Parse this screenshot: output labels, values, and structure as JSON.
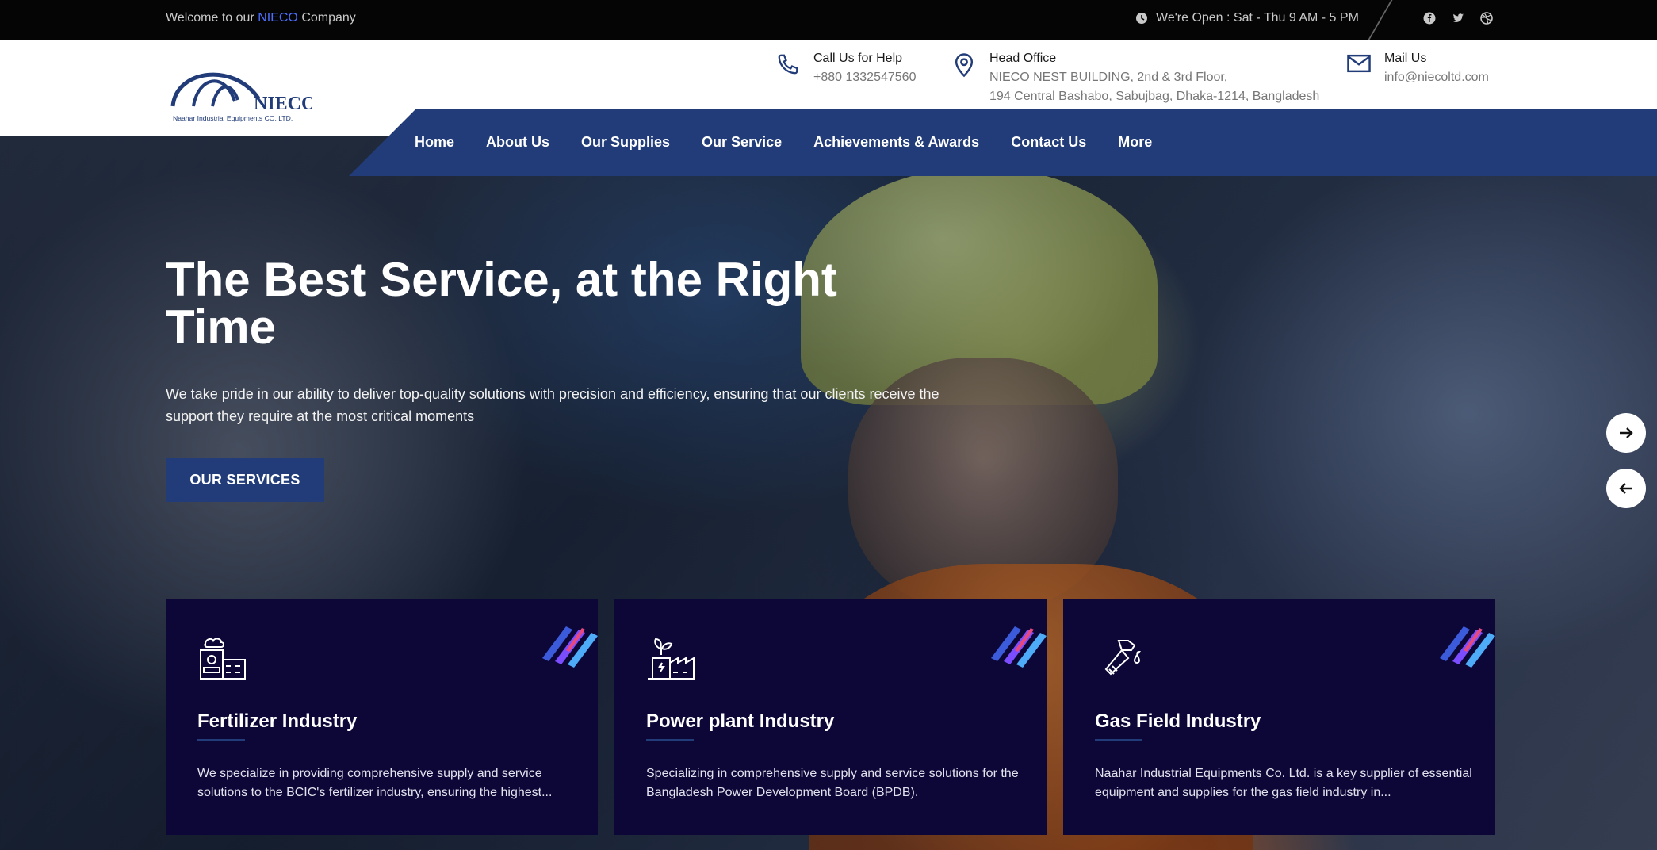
{
  "topbar": {
    "welcome_prefix": "Welcome to our",
    "welcome_brand": "NIECO",
    "welcome_suffix": "Company",
    "hours": "We're Open : Sat - Thu 9 AM - 5 PM",
    "social": [
      "facebook-icon",
      "twitter-icon",
      "dribbble-icon"
    ]
  },
  "logo": {
    "name": "NIECO",
    "tagline": "Naahar Industrial Equipments CO. LTD."
  },
  "contacts": [
    {
      "title": "Call Us for Help",
      "value": "+880 1332547560",
      "icon": "phone-icon"
    },
    {
      "title": "Head Office",
      "value": "NIECO NEST BUILDING, 2nd & 3rd Floor,",
      "value2": "194 Central Bashabo, Sabujbag, Dhaka-1214, Bangladesh",
      "icon": "map-pin-icon"
    },
    {
      "title": "Mail Us",
      "value": "info@niecoltd.com",
      "icon": "mail-icon"
    }
  ],
  "nav": {
    "items": [
      "Home",
      "About Us",
      "Our Supplies",
      "Our Service",
      "Achievements & Awards",
      "Contact Us",
      "More"
    ]
  },
  "hero": {
    "title": "The Best Service, at the Right Time",
    "lead": "We take pride in our ability to deliver top-quality solutions with precision and efficiency, ensuring that our clients receive the support they require at the most critical moments",
    "cta": "OUR SERVICES"
  },
  "cards": [
    {
      "title": "Fertilizer Industry",
      "text": "We specialize in providing comprehensive supply and service solutions to the BCIC's fertilizer industry, ensuring the highest...",
      "icon": "factory-icon"
    },
    {
      "title": "Power plant Industry",
      "text": "Specializing in comprehensive supply and service solutions for the Bangladesh Power Development Board (BPDB).",
      "icon": "power-plant-icon"
    },
    {
      "title": "Gas Field Industry",
      "text": "Naahar Industrial Equipments Co. Ltd. is a key supplier of essential equipment and supplies for the gas field industry in...",
      "icon": "fuel-nozzle-icon"
    }
  ],
  "colors": {
    "brand_blue": "#213c78",
    "card_bg": "#0d0738",
    "accent_link": "#4c6fff"
  }
}
